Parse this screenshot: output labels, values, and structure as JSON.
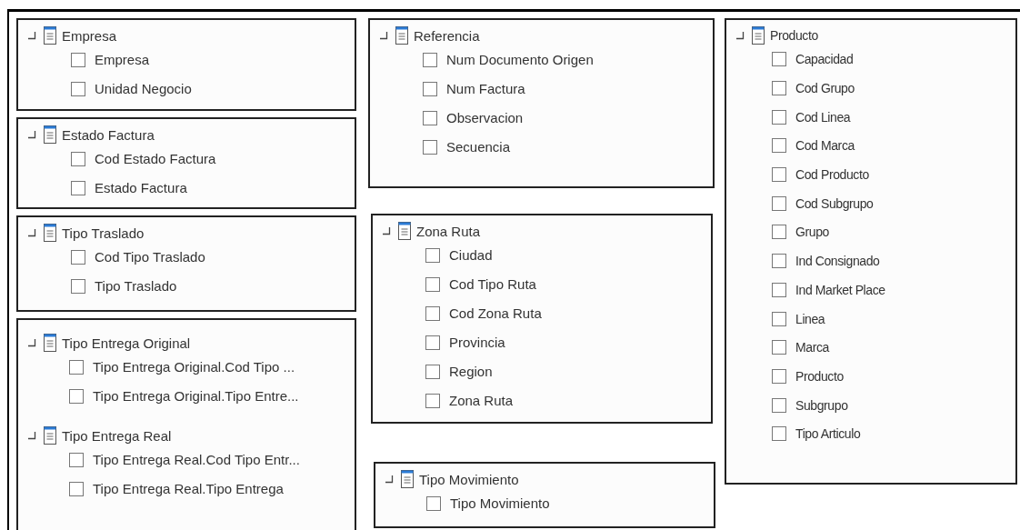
{
  "columns": [
    {
      "panels": [
        {
          "groups": [
            {
              "title": "Empresa",
              "fields": [
                {
                  "label": "Empresa",
                  "checked": false
                },
                {
                  "label": "Unidad Negocio",
                  "checked": false
                }
              ]
            }
          ]
        },
        {
          "groups": [
            {
              "title": "Estado Factura",
              "fields": [
                {
                  "label": "Cod Estado Factura",
                  "checked": false
                },
                {
                  "label": "Estado Factura",
                  "checked": false
                }
              ]
            }
          ]
        },
        {
          "groups": [
            {
              "title": "Tipo Traslado",
              "fields": [
                {
                  "label": "Cod Tipo Traslado",
                  "checked": false
                },
                {
                  "label": "Tipo Traslado",
                  "checked": false
                }
              ]
            }
          ]
        },
        {
          "groups": [
            {
              "title": "Tipo Entrega Original",
              "fields": [
                {
                  "label": "Tipo Entrega Original.Cod Tipo ...",
                  "checked": false
                },
                {
                  "label": "Tipo Entrega Original.Tipo Entre...",
                  "checked": false
                }
              ]
            },
            {
              "title": "Tipo Entrega Real",
              "fields": [
                {
                  "label": "Tipo Entrega Real.Cod Tipo Entr...",
                  "checked": false
                },
                {
                  "label": "Tipo Entrega Real.Tipo Entrega",
                  "checked": false
                }
              ]
            }
          ]
        }
      ]
    },
    {
      "panels": [
        {
          "groups": [
            {
              "title": "Referencia",
              "fields": [
                {
                  "label": "Num Documento Origen",
                  "checked": false
                },
                {
                  "label": "Num Factura",
                  "checked": false
                },
                {
                  "label": "Observacion",
                  "checked": false
                },
                {
                  "label": "Secuencia",
                  "checked": false
                }
              ]
            }
          ]
        },
        {
          "groups": [
            {
              "title": "Zona Ruta",
              "fields": [
                {
                  "label": "Ciudad",
                  "checked": false
                },
                {
                  "label": "Cod Tipo Ruta",
                  "checked": false
                },
                {
                  "label": "Cod Zona Ruta",
                  "checked": false
                },
                {
                  "label": "Provincia",
                  "checked": false
                },
                {
                  "label": "Region",
                  "checked": false
                },
                {
                  "label": "Zona Ruta",
                  "checked": false
                }
              ]
            }
          ]
        },
        {
          "groups": [
            {
              "title": "Tipo Movimiento",
              "fields": [
                {
                  "label": "Tipo Movimiento",
                  "checked": false
                }
              ]
            }
          ]
        }
      ]
    },
    {
      "panels": [
        {
          "groups": [
            {
              "title": "Producto",
              "fields": [
                {
                  "label": "Capacidad",
                  "checked": false
                },
                {
                  "label": "Cod Grupo",
                  "checked": false
                },
                {
                  "label": "Cod Linea",
                  "checked": false
                },
                {
                  "label": "Cod Marca",
                  "checked": false
                },
                {
                  "label": "Cod Producto",
                  "checked": false
                },
                {
                  "label": "Cod Subgrupo",
                  "checked": false
                },
                {
                  "label": "Grupo",
                  "checked": false
                },
                {
                  "label": "Ind Consignado",
                  "checked": false
                },
                {
                  "label": "Ind Market Place",
                  "checked": false
                },
                {
                  "label": "Linea",
                  "checked": false
                },
                {
                  "label": "Marca",
                  "checked": false
                },
                {
                  "label": "Producto",
                  "checked": false
                },
                {
                  "label": "Subgrupo",
                  "checked": false
                },
                {
                  "label": "Tipo Articulo",
                  "checked": false
                }
              ]
            }
          ]
        }
      ]
    }
  ]
}
